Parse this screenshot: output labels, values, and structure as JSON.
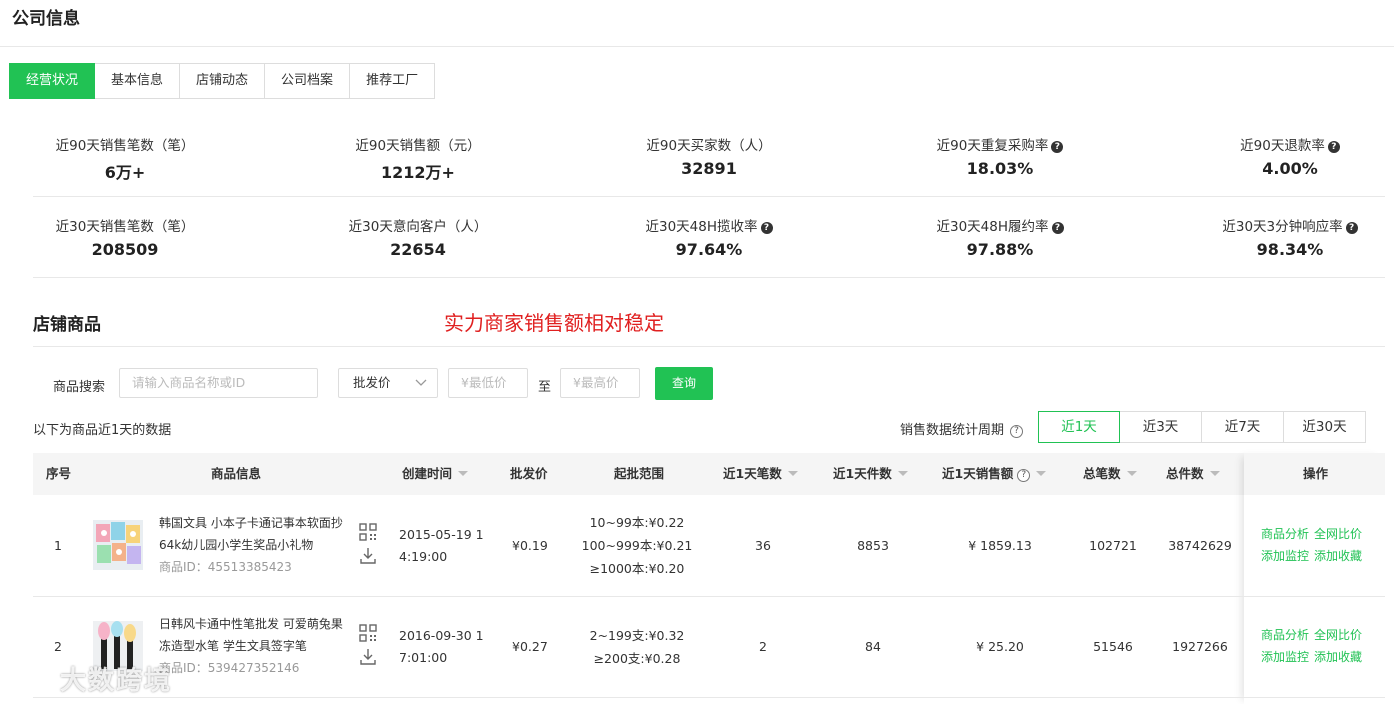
{
  "page_title": "公司信息",
  "tabs": [
    "经营状况",
    "基本信息",
    "店铺动态",
    "公司档案",
    "推荐工厂"
  ],
  "stats_row1": [
    {
      "label": "近90天销售笔数（笔）",
      "value": "6万+",
      "help": false
    },
    {
      "label": "近90天销售额（元）",
      "value": "1212万+",
      "help": false
    },
    {
      "label": "近90天买家数（人）",
      "value": "32891",
      "help": false
    },
    {
      "label": "近90天重复采购率",
      "value": "18.03%",
      "help": true
    },
    {
      "label": "近90天退款率",
      "value": "4.00%",
      "help": true
    }
  ],
  "stats_row2": [
    {
      "label": "近30天销售笔数（笔）",
      "value": "208509",
      "help": false
    },
    {
      "label": "近30天意向客户（人）",
      "value": "22654",
      "help": false
    },
    {
      "label": "近30天48H揽收率",
      "value": "97.64%",
      "help": true
    },
    {
      "label": "近30天48H履约率",
      "value": "97.88%",
      "help": true
    },
    {
      "label": "近30天3分钟响应率",
      "value": "98.34%",
      "help": true
    }
  ],
  "section_title": "店铺商品",
  "slogan": "实力商家销售额相对稳定",
  "search": {
    "label": "商品搜索",
    "placeholder": "请输入商品名称或ID",
    "price_type": "批发价",
    "min_placeholder": "¥最低价",
    "to": "至",
    "max_placeholder": "¥最高价",
    "button": "查询"
  },
  "data_note": "以下为商品近1天的数据",
  "period_label": "销售数据统计周期",
  "periods": [
    "近1天",
    "近3天",
    "近7天",
    "近30天"
  ],
  "active_period": 0,
  "columns": {
    "idx": "序号",
    "info": "商品信息",
    "created": "创建时间",
    "price": "批发价",
    "range": "起批范围",
    "orders_1d": "近1天笔数",
    "pieces_1d": "近1天件数",
    "sales_1d": "近1天销售额",
    "total_orders": "总笔数",
    "total_pieces": "总件数",
    "ops": "操作"
  },
  "rows": [
    {
      "idx": "1",
      "name_line1": "韩国文具 小本子卡通记事本软面抄",
      "name_line2": "64k幼儿园小学生奖品小礼物",
      "id_text": "商品ID：45513385423",
      "created_line1": "2015-05-19 1",
      "created_line2": "4:19:00",
      "price": "¥0.19",
      "range": [
        "10~99本:¥0.22",
        "100~999本:¥0.21",
        "≥1000本:¥0.20"
      ],
      "orders_1d": "36",
      "pieces_1d": "8853",
      "sales_1d": "¥ 1859.13",
      "total_orders": "102721",
      "total_pieces": "38742629",
      "ops": [
        "商品分析",
        "全网比价",
        "添加监控",
        "添加收藏"
      ]
    },
    {
      "idx": "2",
      "name_line1": "日韩风卡通中性笔批发 可爱萌兔果",
      "name_line2": "冻造型水笔 学生文具签字笔",
      "id_text": "商品ID：539427352146",
      "created_line1": "2016-09-30 1",
      "created_line2": "7:01:00",
      "price": "¥0.27",
      "range": [
        "2~199支:¥0.32",
        "≥200支:¥0.28"
      ],
      "orders_1d": "2",
      "pieces_1d": "84",
      "sales_1d": "¥ 25.20",
      "total_orders": "51546",
      "total_pieces": "1927266",
      "ops": [
        "商品分析",
        "全网比价",
        "添加监控",
        "添加收藏"
      ]
    }
  ],
  "watermark": "大数跨境",
  "colors": {
    "accent": "#21c254",
    "slogan": "#e02020"
  }
}
